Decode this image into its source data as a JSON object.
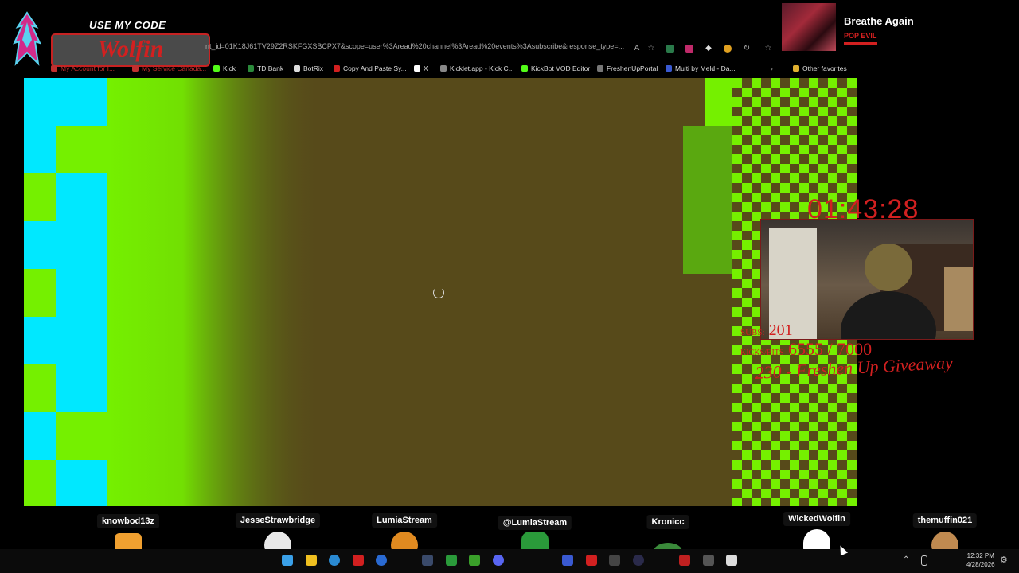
{
  "promo": {
    "header": "USE MY CODE",
    "code": "Wolfin"
  },
  "browser": {
    "address": "nt_id=01K18J61TV29Z2RSKFGXSBCPX7&scope=user%3Aread%20channel%3Aread%20events%3Asubscribe&response_type=...",
    "bookmarks": [
      {
        "label": "My Account for I...",
        "color": "#c03030"
      },
      {
        "label": "My Service Canada...",
        "color": "#c03030"
      },
      {
        "label": "Kick",
        "color": "#53fc18"
      },
      {
        "label": "TD Bank",
        "color": "#2a8a3a"
      },
      {
        "label": "BotRix",
        "color": "#dddddd"
      },
      {
        "label": "Copy And Paste Sy...",
        "color": "#d22020"
      },
      {
        "label": "X",
        "color": "#ffffff"
      },
      {
        "label": "Kicklet.app - Kick C...",
        "color": "#888888"
      },
      {
        "label": "KickBot VOD Editor",
        "color": "#53fc18"
      },
      {
        "label": "FreshenUpPortal",
        "color": "#777777"
      },
      {
        "label": "Multi by Meld - Da...",
        "color": "#3a5ad2"
      }
    ],
    "other_favorites": "Other favorites"
  },
  "now_playing": {
    "title": "Breathe Again",
    "artist": "POP EVIL"
  },
  "overlay": {
    "timer": "01:43:28",
    "subs_label": "SUBS:",
    "subs_value": "201",
    "bits_label": "KICKS/BITS",
    "bits_value": "6555 / 7000",
    "giveaway": "230 - Freshen Up Giveaway"
  },
  "chatters": [
    {
      "name": "knowbod13z",
      "avatar": "#f0a030"
    },
    {
      "name": "JesseStrawbridge",
      "avatar": "#e8e8e8"
    },
    {
      "name": "LumiaStream",
      "avatar": "#e08a20"
    },
    {
      "name": "@LumiaStream",
      "avatar": "#2a9a3a"
    },
    {
      "name": "Kronicc",
      "avatar": "#3a8a3a"
    },
    {
      "name": "WickedWolfin",
      "avatar": "#ffffff"
    },
    {
      "name": "themuffin021",
      "avatar": "#c08a50"
    }
  ],
  "taskbar": {
    "time": "12:32 PM",
    "date": "4/28/2026"
  },
  "colors": {
    "green": "#75f000",
    "cyan": "#00e8ff",
    "content_bg": "#574a1a",
    "accent_red": "#d22020"
  }
}
